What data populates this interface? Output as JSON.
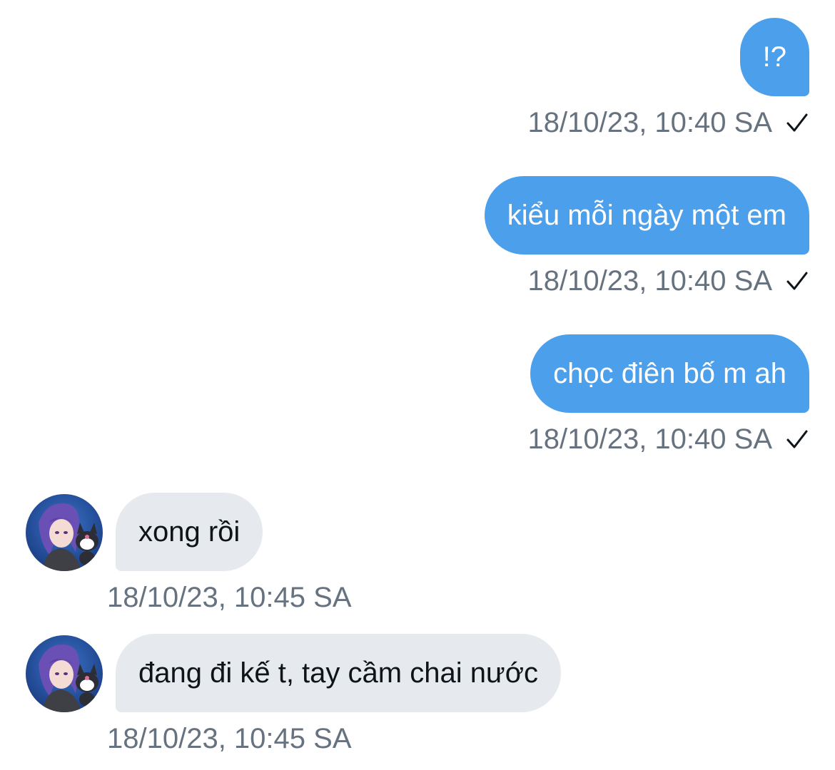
{
  "messages": [
    {
      "direction": "out",
      "text": "!?",
      "timestamp": "18/10/23, 10:40 SA",
      "status_icon": "check-icon"
    },
    {
      "direction": "out",
      "text": "kiểu mỗi ngày một em",
      "timestamp": "18/10/23, 10:40 SA",
      "status_icon": "check-icon"
    },
    {
      "direction": "out",
      "text": "chọc điên bố m ah",
      "timestamp": "18/10/23, 10:40 SA",
      "status_icon": "check-icon"
    },
    {
      "direction": "in",
      "text": "xong rồi",
      "timestamp": "18/10/23, 10:45 SA",
      "avatar_icon": "avatar"
    },
    {
      "direction": "in",
      "text": "đang đi kế t, tay cầm chai nước",
      "timestamp": "18/10/23, 10:45 SA",
      "avatar_icon": "avatar"
    }
  ],
  "colors": {
    "outgoing_bubble": "#4c9feb",
    "incoming_bubble": "#e6eaee",
    "timestamp_text": "#66727f"
  }
}
